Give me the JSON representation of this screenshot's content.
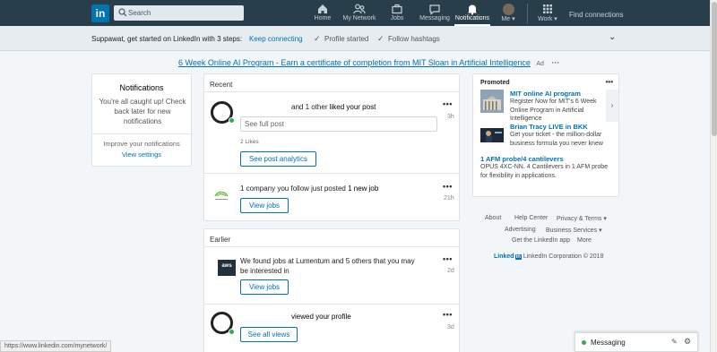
{
  "nav": {
    "logo": "in",
    "search_placeholder": "Search",
    "items": [
      {
        "label": "Home",
        "icon": "home-icon"
      },
      {
        "label": "My Network",
        "icon": "network-icon"
      },
      {
        "label": "Jobs",
        "icon": "briefcase-icon"
      },
      {
        "label": "Messaging",
        "icon": "chat-icon"
      },
      {
        "label": "Notifications",
        "icon": "bell-icon",
        "active": true
      },
      {
        "label": "Me ▾",
        "icon": "avatar"
      },
      {
        "label": "Work ▾",
        "icon": "grid-icon"
      }
    ],
    "find_connections": "Find connections"
  },
  "banner": {
    "message": "Suppawat, get started on LinkedIn with 3 steps:",
    "steps": [
      "Keep connecting",
      "Profile started",
      "Follow hashtags"
    ]
  },
  "ad": {
    "link": "6 Week Online AI Program - Earn a certificate of completion from MIT Sloan in Artificial Intelligence",
    "tag": "Ad",
    "dots": "···"
  },
  "left_card": {
    "title": "Notifications",
    "subtitle": "You're all caught up! Check back later for new notifications",
    "improve": "Improve your notifications",
    "view_settings": "View settings"
  },
  "recent": {
    "heading": "Recent",
    "items": [
      {
        "text_plain": "and 1 other ",
        "text_bold": "liked your post",
        "time": "3h",
        "input_placeholder": "See full post",
        "likes": "2 Likes",
        "button": "See post analytics",
        "dots": "•••"
      },
      {
        "text_plain": "1 company you follow just posted ",
        "text_bold": "1 new job",
        "time": "21h",
        "button": "View jobs",
        "dots": "•••"
      }
    ]
  },
  "earlier": {
    "heading": "Earlier",
    "items": [
      {
        "text": "We found jobs at Lumentum and 5 others that you may be interested in",
        "time": "2d",
        "button": "View jobs",
        "dots": "•••",
        "logo": "aws"
      },
      {
        "text": "viewed your profile",
        "time": "3d",
        "button": "See all views",
        "dots": "•••"
      }
    ]
  },
  "promoted": {
    "label": "Promoted",
    "dots": "•••",
    "items": [
      {
        "title": "MIT online AI program",
        "desc": "Register Now for MIT's 6 Week Online Program in Artificial Intelligence"
      },
      {
        "title": "Brian Tracy LIVE in BKK",
        "desc": "Get your ticket - the million-dollar business formula you never knew"
      },
      {
        "title": "1 AFM probe/4 cantilevers",
        "desc": "OPUS 4XC-NN. 4 Cantilevers in 1 AFM probe for flexibility in applications."
      }
    ]
  },
  "footer": {
    "links": [
      "About",
      "Help Center",
      "Privacy & Terms ▾",
      "Advertising",
      "Business Services ▾",
      "Get the LinkedIn app",
      "More"
    ],
    "brand": "Linked",
    "brand_in": "in",
    "copyright": "LinkedIn Corporation © 2018"
  },
  "messaging": {
    "label": "Messaging"
  },
  "status_url": "https://www.linkedin.com/mynetwork/"
}
